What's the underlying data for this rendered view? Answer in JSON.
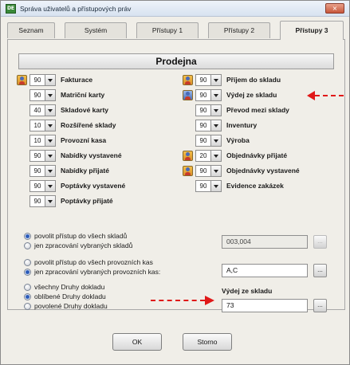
{
  "window": {
    "title": "Správa uživatelů a přístupových práv",
    "close_icon": "×"
  },
  "tabs": [
    {
      "label": "Seznam",
      "active": false
    },
    {
      "label": "Systém",
      "active": false
    },
    {
      "label": "Přístupy 1",
      "active": false
    },
    {
      "label": "Přístupy 2",
      "active": false
    },
    {
      "label": "Přístupy 3",
      "active": true
    }
  ],
  "section": {
    "title": "Prodejna"
  },
  "permissions_left": [
    {
      "label": "Fakturace",
      "level": "90",
      "avatar": true
    },
    {
      "label": "Matriční karty",
      "level": "90",
      "avatar": false
    },
    {
      "label": "Skladové karty",
      "level": "40",
      "avatar": false
    },
    {
      "label": "Rozšířené sklady",
      "level": "10",
      "avatar": false
    },
    {
      "label": "Provozní kasa",
      "level": "10",
      "avatar": false
    },
    {
      "label": "Nabídky vystavené",
      "level": "90",
      "avatar": false
    },
    {
      "label": "Nabídky přijaté",
      "level": "90",
      "avatar": false
    },
    {
      "label": "Poptávky vystavené",
      "level": "90",
      "avatar": false
    },
    {
      "label": "Poptávky přijaté",
      "level": "90",
      "avatar": false
    }
  ],
  "permissions_right": [
    {
      "label": "Příjem do skladu",
      "level": "90",
      "avatar": true
    },
    {
      "label": "Výdej ze skladu",
      "level": "90",
      "avatar": true
    },
    {
      "label": "Převod mezi sklady",
      "level": "90",
      "avatar": false
    },
    {
      "label": "Inventury",
      "level": "90",
      "avatar": false
    },
    {
      "label": "Výroba",
      "level": "90",
      "avatar": false
    },
    {
      "label": "Objednávky přijaté",
      "level": "20",
      "avatar": true
    },
    {
      "label": "Objednávky vystavené",
      "level": "90",
      "avatar": true
    },
    {
      "label": "Evidence zakázek",
      "level": "90",
      "avatar": false
    }
  ],
  "warehouse_access": {
    "options": [
      {
        "label": "povolit přístup do všech skladů",
        "checked": true
      },
      {
        "label": "jen zpracování vybraných skladů",
        "checked": false
      }
    ],
    "value": "003,004",
    "button": "..."
  },
  "cashdesk_access": {
    "options": [
      {
        "label": "povolit přístup do všech provozních kas",
        "checked": false
      },
      {
        "label": "jen zpracování vybraných provozních kas:",
        "checked": true
      }
    ],
    "value": "A,C",
    "button": "..."
  },
  "doc_types": {
    "options": [
      {
        "label": "všechny Druhy dokladu",
        "checked": false
      },
      {
        "label": "oblíbené Druhy dokladu",
        "checked": true
      },
      {
        "label": "povolené Druhy dokladu",
        "checked": false
      }
    ],
    "field_label": "Výdej ze skladu",
    "value": "73",
    "button": "..."
  },
  "buttons": {
    "ok": "OK",
    "cancel": "Storno"
  },
  "colors": {
    "accent_arrow": "#e01818",
    "checked_radio": "#2a5ab8"
  }
}
